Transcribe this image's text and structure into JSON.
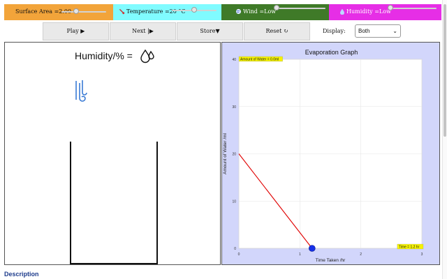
{
  "params": {
    "surface_area": {
      "label": "Surface Area =2.00",
      "slider_value": 0.3
    },
    "temperature": {
      "label": "Temperature =20 °C",
      "icon": "thermometer-icon",
      "slider_value": 0.5
    },
    "wind": {
      "label": "Wind =Low",
      "icon": "wind-icon",
      "slider_value": 0.0
    },
    "humidity": {
      "label": "Humidity =Low",
      "icon": "droplet-icon",
      "slider_value": 0.0
    }
  },
  "toolbar": {
    "play": "Play ▶",
    "next": "Next |▶",
    "store": "Store▼",
    "reset": "Reset ↻",
    "display_label": "Display:",
    "display_value": "Both"
  },
  "sim": {
    "humidity_title": "Humidity/% ="
  },
  "chart_data": {
    "type": "line",
    "title": "Evaporation Graph",
    "xlabel": "Time Taken /hr",
    "ylabel": "Amount of Water /ml",
    "xlim": [
      0,
      3
    ],
    "ylim": [
      0,
      40
    ],
    "x_ticks": [
      0,
      1,
      2,
      3
    ],
    "y_ticks": [
      0,
      10,
      20,
      30,
      40
    ],
    "grid": true,
    "x": [
      0,
      1.2
    ],
    "y": [
      20,
      0
    ],
    "line_color": "#e00000",
    "marker_color": "#1630e8",
    "annotations": {
      "top_left": "Amount of Water = 0.0ml",
      "bottom_right": "Time = 1.2 hr"
    }
  },
  "colors": {
    "surface_area": "#f2a43a",
    "temperature": "#80fbff",
    "wind": "#3f7a28",
    "humidity": "#e62ee6",
    "graph_bg": "#d2d6fb"
  },
  "footer": {
    "description": "Description"
  }
}
